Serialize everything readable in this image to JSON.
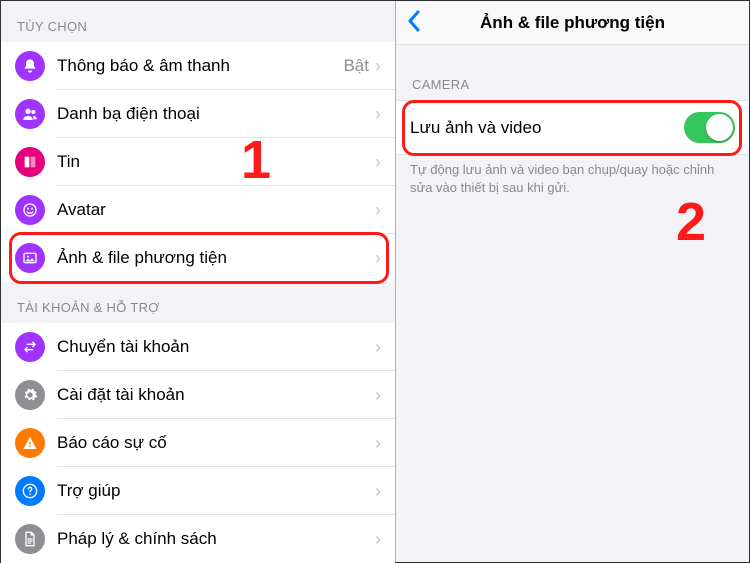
{
  "left": {
    "section1_header": "TÙY CHỌN",
    "rows1": [
      {
        "label": "Thông báo & âm thanh",
        "value": "Bật"
      },
      {
        "label": "Danh bạ điện thoại"
      },
      {
        "label": "Tin"
      },
      {
        "label": "Avatar"
      },
      {
        "label": "Ảnh & file phương tiện"
      }
    ],
    "section2_header": "TÀI KHOẢN & HỖ TRỢ",
    "rows2": [
      {
        "label": "Chuyển tài khoản"
      },
      {
        "label": "Cài đặt tài khoản"
      },
      {
        "label": "Báo cáo sự cố"
      },
      {
        "label": "Trợ giúp"
      },
      {
        "label": "Pháp lý & chính sách"
      }
    ]
  },
  "right": {
    "title": "Ảnh & file phương tiện",
    "section_header": "CAMERA",
    "toggle_label": "Lưu ảnh và video",
    "footer": "Tự động lưu ảnh và video bạn chụp/quay hoặc chỉnh sửa vào thiết bị sau khi gửi."
  },
  "annotations": {
    "one": "1",
    "two": "2"
  }
}
